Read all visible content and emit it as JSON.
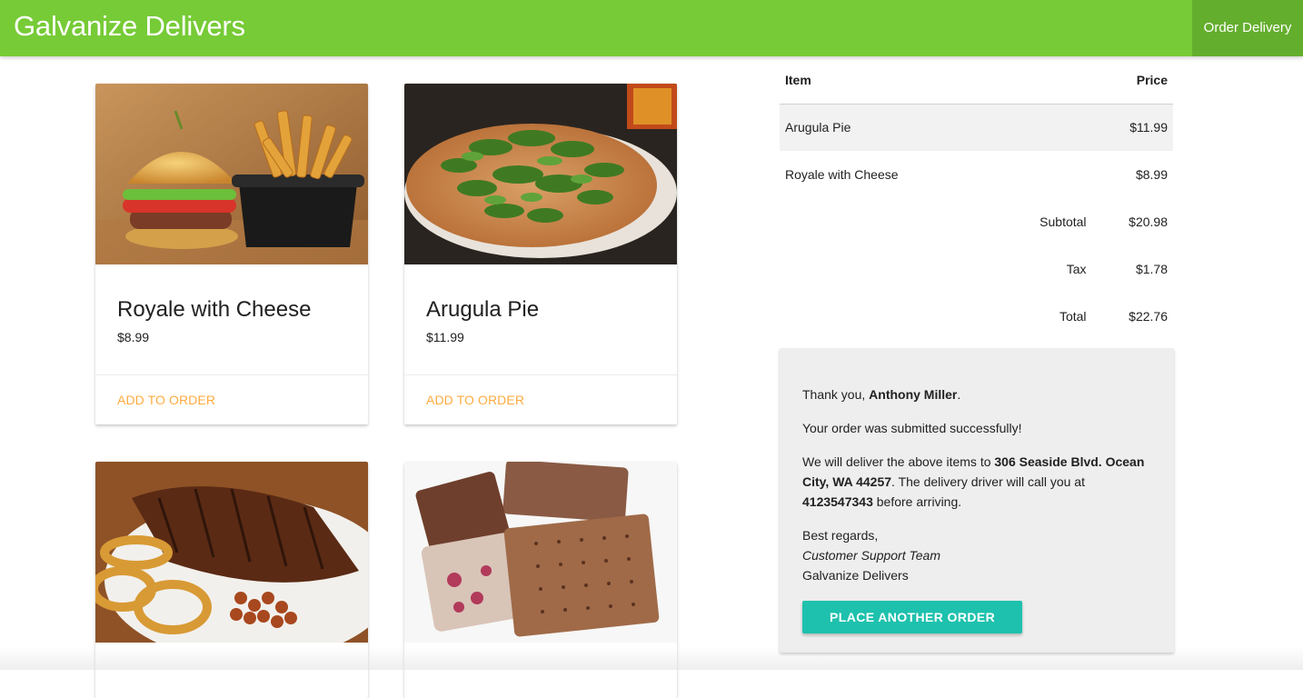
{
  "header": {
    "brand": "Galvanize Delivers",
    "nav_link": "Order Delivery",
    "background_color": "#76cb36"
  },
  "menu": {
    "items": [
      {
        "name": "Royale with Cheese",
        "price": "$8.99",
        "action": "ADD TO ORDER",
        "image": "burger-and-fries-photo"
      },
      {
        "name": "Arugula Pie",
        "price": "$11.99",
        "action": "ADD TO ORDER",
        "image": "arugula-pizza-photo"
      },
      {
        "image": "ribs-and-onion-rings-photo"
      },
      {
        "image": "ice-cream-sandwich-photo"
      }
    ]
  },
  "order": {
    "headers": {
      "item": "Item",
      "price": "Price"
    },
    "rows": [
      {
        "item": "Arugula Pie",
        "price": "$11.99"
      },
      {
        "item": "Royale with Cheese",
        "price": "$8.99"
      }
    ],
    "subtotal_label": "Subtotal",
    "subtotal": "$20.98",
    "tax_label": "Tax",
    "tax": "$1.78",
    "total_label": "Total",
    "total": "$22.76"
  },
  "confirmation": {
    "thanks_prefix": "Thank you, ",
    "customer_name": "Anthony Miller",
    "thanks_suffix": ".",
    "success_message": "Your order was submitted successfully!",
    "deliver_prefix": "We will deliver the above items to ",
    "address": "306 Seaside Blvd. Ocean City, WA 44257",
    "deliver_middle": ". The delivery driver will call you at ",
    "phone": "4123547343",
    "deliver_suffix": " before arriving.",
    "regards": "Best regards,",
    "team": "Customer Support Team",
    "company": "Galvanize Delivers",
    "button_label": "PLACE ANOTHER ORDER",
    "button_color": "#1ec1ad"
  },
  "colors": {
    "accent_action": "#ffab40",
    "panel_background": "#eeeeee"
  }
}
